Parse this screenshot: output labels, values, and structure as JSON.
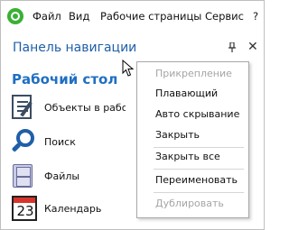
{
  "menubar": {
    "items": [
      "Файл",
      "Вид",
      "Рабочие страницы",
      "Сервис",
      "?"
    ]
  },
  "nav_panel": {
    "title": "Панель навигации",
    "pin_glyph": "▾",
    "close_glyph": "✕",
    "section_title": "Рабочий стол",
    "items": [
      {
        "label": "Объекты в рабо",
        "icon": "document-edit-icon"
      },
      {
        "label": "Поиск",
        "icon": "search-icon"
      },
      {
        "label": "Файлы",
        "icon": "file-cabinet-icon"
      },
      {
        "label": "Календарь",
        "icon": "calendar-icon",
        "icon_text": "23"
      }
    ]
  },
  "context_menu": {
    "items": [
      {
        "label": "Прикрепление",
        "enabled": false
      },
      {
        "label": "Плавающий",
        "enabled": true
      },
      {
        "label": "Авто скрывание",
        "enabled": true
      },
      {
        "label": "Закрыть",
        "enabled": true
      },
      {
        "label": "Закрыть все",
        "enabled": true
      },
      {
        "label": "Переименовать",
        "enabled": true
      },
      {
        "label": "Дублировать",
        "enabled": false
      }
    ]
  },
  "colors": {
    "accent": "#1f5fa8",
    "section": "#1f6fc1",
    "app_icon": "#3bb035",
    "disabled_text": "#a5a5a5"
  }
}
